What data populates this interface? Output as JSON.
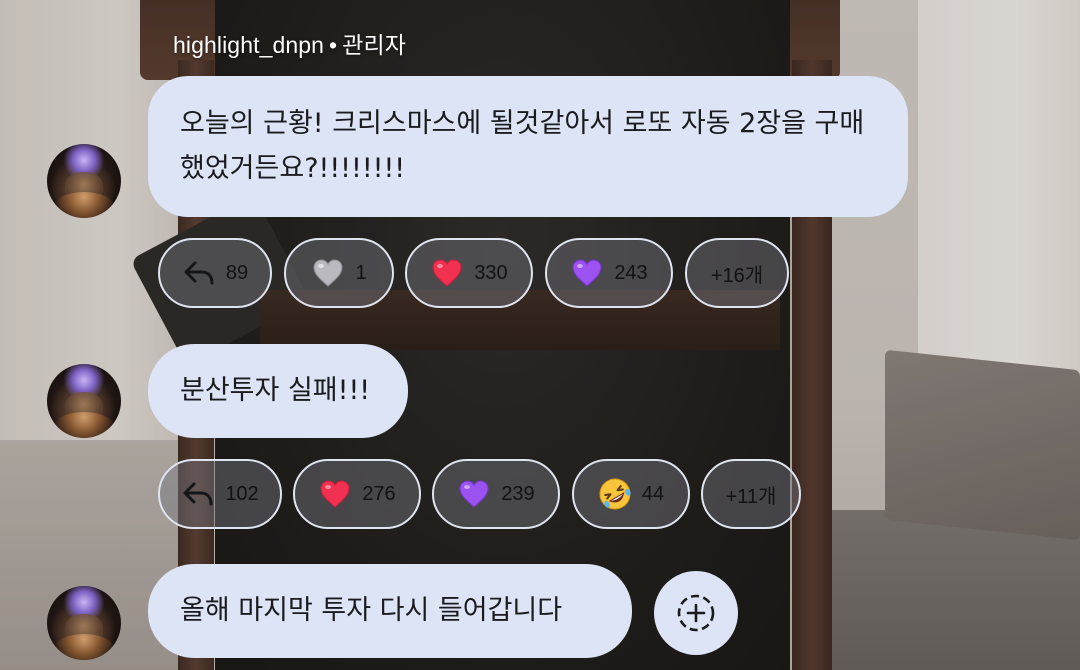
{
  "header": {
    "username": "highlight_dnpn",
    "separator": "•",
    "role": "관리자"
  },
  "messages": [
    {
      "text": "오늘의 근황! 크리스마스에 될것같아서 로또 자동 2장을 구매했었거든요?!!!!!!!!",
      "reactions": [
        {
          "icon": "reply-arrow-icon",
          "count": "89"
        },
        {
          "icon": "grey-heart-icon",
          "count": "1",
          "color": "#b8b8bd"
        },
        {
          "icon": "red-heart-icon",
          "count": "330",
          "color": "#f2304f"
        },
        {
          "icon": "purple-heart-icon",
          "count": "243",
          "color": "#9b52f0"
        }
      ],
      "more": "+16개"
    },
    {
      "text": "분산투자 실패!!!",
      "reactions": [
        {
          "icon": "reply-arrow-icon",
          "count": "102"
        },
        {
          "icon": "red-heart-icon",
          "count": "276",
          "color": "#f2304f"
        },
        {
          "icon": "purple-heart-icon",
          "count": "239",
          "color": "#9b52f0"
        },
        {
          "icon": "rofl-emoji-icon",
          "count": "44",
          "color": "#f7c43b"
        }
      ],
      "more": "+11개"
    },
    {
      "text": "올해 마지막 투자 다시 들어갑니다",
      "add_reaction": "add-reaction-icon"
    }
  ],
  "colors": {
    "bubble": "#dde4f5",
    "pill_border": "#dfe4f0",
    "text": "#1a1b1f"
  }
}
